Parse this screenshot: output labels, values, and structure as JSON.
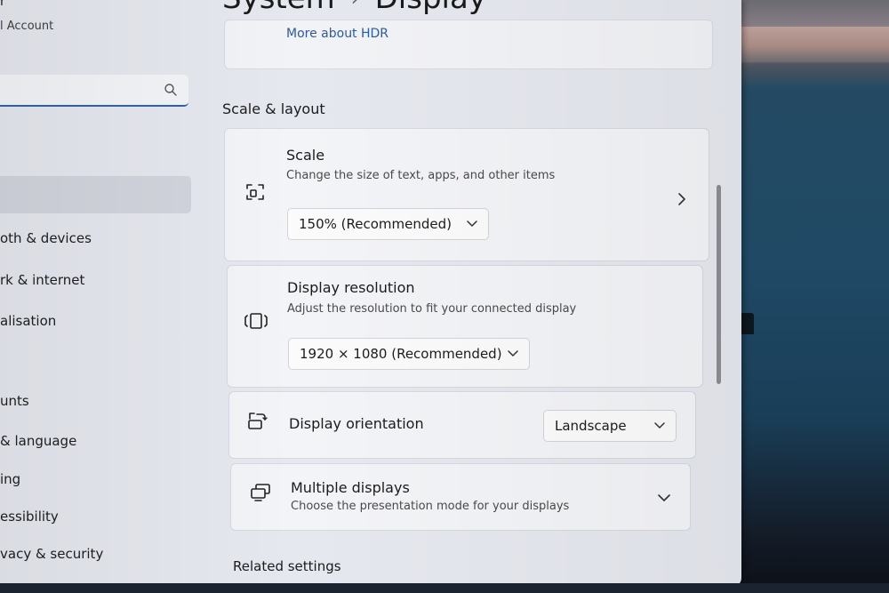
{
  "account": {
    "name": "r",
    "type": "l Account"
  },
  "search": {
    "placeholder": ""
  },
  "nav": {
    "items": [
      {
        "label": "oth & devices"
      },
      {
        "label": "rk & internet"
      },
      {
        "label": "alisation"
      },
      {
        "label": "unts"
      },
      {
        "label": "& language"
      },
      {
        "label": "ing"
      },
      {
        "label": "essibility"
      },
      {
        "label": "vacy & security"
      }
    ]
  },
  "header": {
    "crumb1": "System",
    "separator": "›",
    "crumb2": "Display"
  },
  "hdr": {
    "link": "More about HDR"
  },
  "scale_layout": {
    "section_title": "Scale & layout",
    "scale": {
      "title": "Scale",
      "desc": "Change the size of text, apps, and other items",
      "value": "150% (Recommended)"
    },
    "resolution": {
      "title": "Display resolution",
      "desc": "Adjust the resolution to fit your connected display",
      "value": "1920 × 1080 (Recommended)"
    },
    "orientation": {
      "title": "Display orientation",
      "value": "Landscape"
    },
    "multiple": {
      "title": "Multiple displays",
      "desc": "Choose the presentation mode for your displays"
    }
  },
  "related": {
    "title": "Related settings"
  },
  "colors": {
    "accent": "#2f63b0",
    "window_bg": "#e6e8ef",
    "card_bg": "#f3f4f7"
  }
}
